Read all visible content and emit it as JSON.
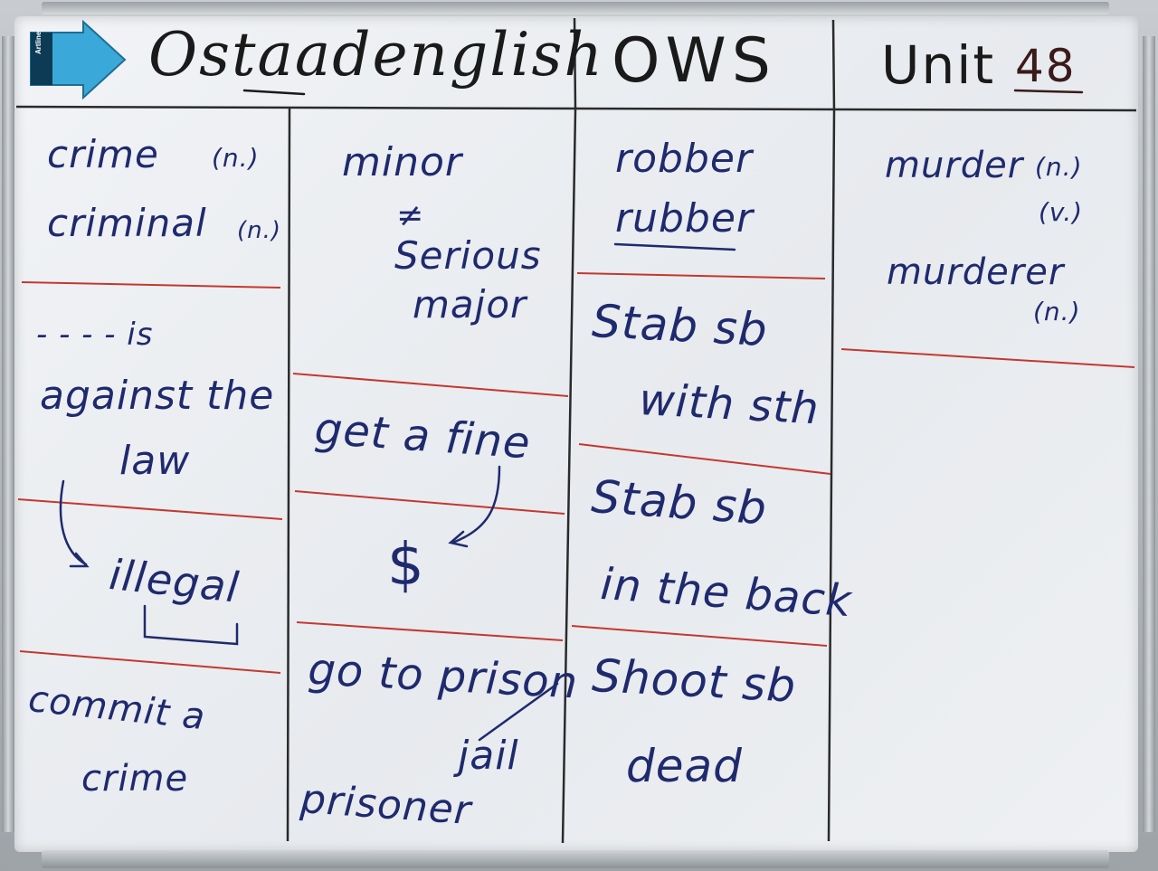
{
  "header": {
    "site": "Ostaadenglish",
    "series": "OWS",
    "unit_label": "Unit",
    "unit_number": "48"
  },
  "eraser": {
    "brand": "Artline"
  },
  "column1": {
    "crime": "crime",
    "crime_pos": "(n.)",
    "criminal": "criminal",
    "criminal_pos": "(n.)",
    "blank": "- - - - is",
    "against": "against the",
    "law": "law",
    "illegal": "illegal",
    "commit": "commit a",
    "commit_crime": "crime"
  },
  "column2": {
    "minor": "minor",
    "not_equal": "≠",
    "serious": "Serious",
    "major": "major",
    "get_fine": "get a fine",
    "dollar": "$",
    "go_prison": "go to prison",
    "jail": "jail",
    "prisoner": "prisoner"
  },
  "column3": {
    "robber": "robber",
    "rubber": "rubber",
    "stab_sb": "Stab sb",
    "with_sth": "with sth",
    "stab_sb2": "Stab sb",
    "in_back": "in the back",
    "shoot_sb": "Shoot sb",
    "dead": "dead"
  },
  "column4": {
    "murder": "murder",
    "murder_n": "(n.)",
    "murder_v": "(v.)",
    "murderer": "murderer",
    "murderer_n": "(n.)"
  },
  "colors": {
    "ink_blue": "#1f2a6e",
    "ink_black": "#1a1a1a",
    "ink_red": "#c4382f",
    "eraser_blue": "#3aa8d8"
  }
}
